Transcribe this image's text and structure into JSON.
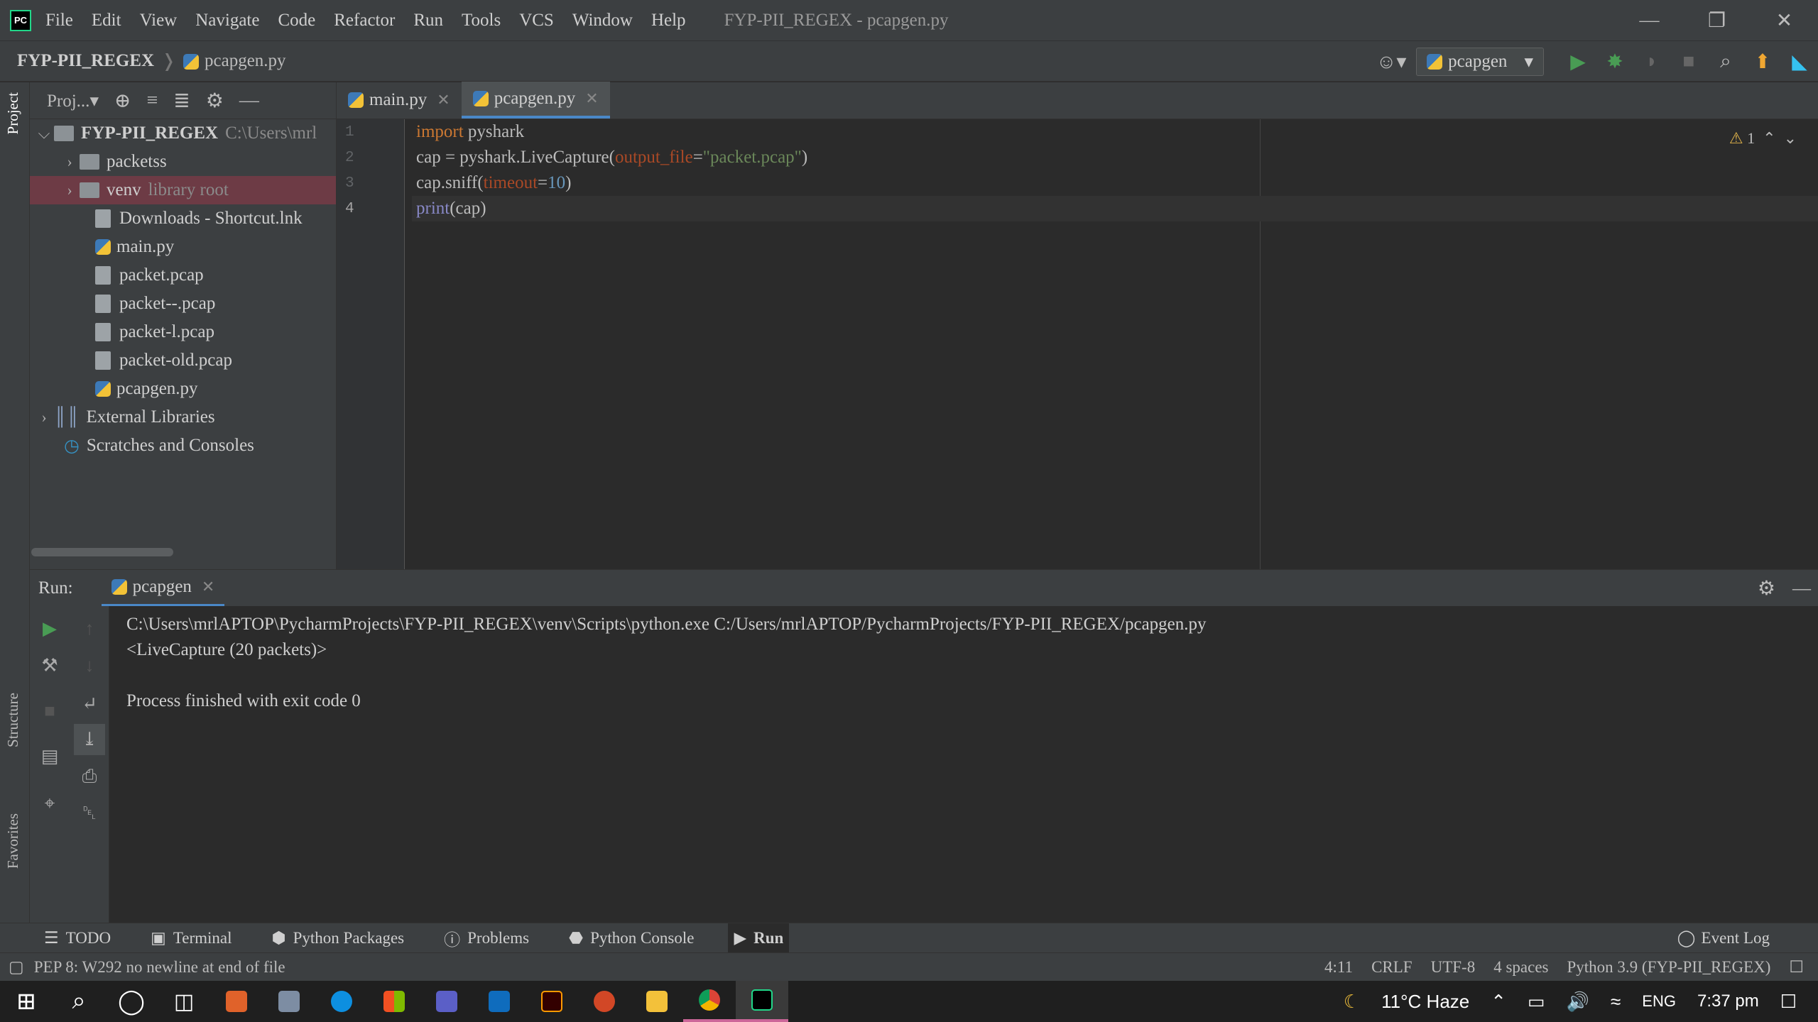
{
  "app": {
    "logo": "PC",
    "title": "FYP-PII_REGEX - pcapgen.py"
  },
  "menu": [
    "File",
    "Edit",
    "View",
    "Navigate",
    "Code",
    "Refactor",
    "Run",
    "Tools",
    "VCS",
    "Window",
    "Help"
  ],
  "breadcrumb": {
    "project": "FYP-PII_REGEX",
    "file": "pcapgen.py"
  },
  "run_config": "pcapgen",
  "project_panel": {
    "title": "Proj...",
    "tree": [
      {
        "label": "FYP-PII_REGEX",
        "extra": "C:\\Users\\mrl",
        "type": "root"
      },
      {
        "label": "packetss",
        "type": "folder"
      },
      {
        "label": "venv",
        "extra": "library root",
        "type": "folder"
      },
      {
        "label": "Downloads - Shortcut.lnk",
        "type": "file"
      },
      {
        "label": "main.py",
        "type": "py"
      },
      {
        "label": "packet.pcap",
        "type": "file"
      },
      {
        "label": "packet--.pcap",
        "type": "file"
      },
      {
        "label": "packet-l.pcap",
        "type": "file"
      },
      {
        "label": "packet-old.pcap",
        "type": "file"
      },
      {
        "label": "pcapgen.py",
        "type": "py"
      },
      {
        "label": "External Libraries",
        "type": "lib"
      },
      {
        "label": "Scratches and Consoles",
        "type": "scratch"
      }
    ]
  },
  "editor": {
    "tabs": [
      {
        "label": "main.py"
      },
      {
        "label": "pcapgen.py"
      }
    ],
    "lines": [
      "1",
      "2",
      "3",
      "4"
    ],
    "code": {
      "l1a": "import",
      "l1b": " pyshark",
      "l2a": "cap = pyshark.LiveCapture(",
      "l2b": "output_file",
      "l2c": "=",
      "l2d": "\"packet.pcap\"",
      "l2e": ")",
      "l3a": "cap.sniff(",
      "l3b": "timeout",
      "l3c": "=",
      "l3d": "10",
      "l3e": ")",
      "l4a": "print",
      "l4b": "(cap)"
    },
    "warnings": "1"
  },
  "run": {
    "label": "Run:",
    "tab": "pcapgen",
    "output": [
      "C:\\Users\\mrlAPTOP\\PycharmProjects\\FYP-PII_REGEX\\venv\\Scripts\\python.exe C:/Users/mrlAPTOP/PycharmProjects/FYP-PII_REGEX/pcapgen.py",
      "<LiveCapture (20 packets)>",
      "",
      "Process finished with exit code 0"
    ]
  },
  "side_labels": {
    "project": "Project",
    "structure": "Structure",
    "favorites": "Favorites"
  },
  "toolwindows": [
    "TODO",
    "Terminal",
    "Python Packages",
    "Problems",
    "Python Console",
    "Run"
  ],
  "status": {
    "message": "PEP 8: W292 no newline at end of file",
    "position": "4:11",
    "line_sep": "CRLF",
    "encoding": "UTF-8",
    "indent": "4 spaces",
    "interpreter": "Python 3.9 (FYP-PII_REGEX)",
    "event_log": "Event Log"
  },
  "taskbar": {
    "weather": "11°C  Haze",
    "lang": "ENG",
    "time": "7:37 pm"
  }
}
